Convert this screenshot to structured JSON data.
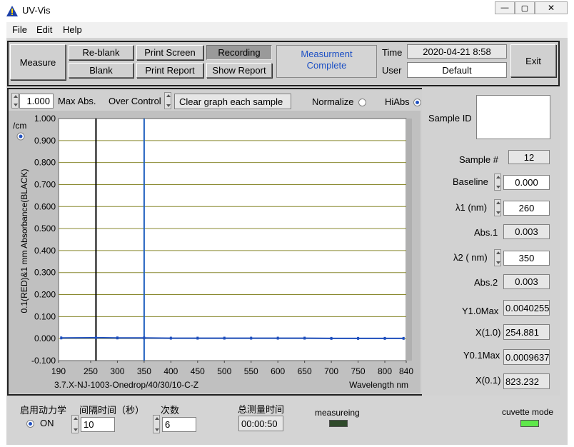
{
  "window": {
    "title": "UV-Vis",
    "minimize": "—",
    "maximize": "▢",
    "close": "✕"
  },
  "menu": [
    "File",
    "Edit",
    "Help"
  ],
  "toolbar": {
    "measure": "Measure",
    "reblank": "Re-blank",
    "blank": "Blank",
    "print_screen": "Print Screen",
    "print_report": "Print Report",
    "recording": "Recording",
    "show_report": "Show Report",
    "status": "Measurment Complete",
    "time_label": "Time",
    "time_value": "2020-04-21 8:58",
    "user_label": "User",
    "user_value": "Default",
    "exit": "Exit"
  },
  "controls": {
    "max_abs_value": "1.000",
    "max_abs_label": "Max Abs.",
    "over_control_label": "Over Control",
    "over_control_value": "Clear graph each sample",
    "normalize_label": "Normalize",
    "normalize_on": false,
    "hiabs_label": "HiAbs",
    "hiabs_on": true
  },
  "chart_data": {
    "type": "line",
    "unit_label": "/cm",
    "ylabel": "0.1(RED)&1 mm Absorbance(BLACK)",
    "xlabel": "Wavelength nm",
    "sample_caption": "3.7.X-NJ-1003-Onedrop/40/30/10-C-Z",
    "xlim": [
      190,
      840
    ],
    "ylim": [
      -0.1,
      1.0
    ],
    "x_ticks": [
      "190",
      "250",
      "300",
      "350",
      "400",
      "450",
      "500",
      "550",
      "600",
      "650",
      "700",
      "750",
      "800",
      "840"
    ],
    "x_tick_values": [
      190,
      250,
      300,
      350,
      400,
      450,
      500,
      550,
      600,
      650,
      700,
      750,
      800,
      840
    ],
    "y_ticks": [
      "1.000",
      "0.900",
      "0.800",
      "0.700",
      "0.600",
      "0.500",
      "0.400",
      "0.300",
      "0.200",
      "0.100",
      "0.000",
      "-0.100"
    ],
    "y_tick_values": [
      1.0,
      0.9,
      0.8,
      0.7,
      0.6,
      0.5,
      0.4,
      0.3,
      0.2,
      0.1,
      0.0,
      -0.1
    ],
    "cursors": [
      {
        "x": 260,
        "color": "#000000"
      },
      {
        "x": 350,
        "color": "#1f5fbf"
      }
    ],
    "series": [
      {
        "color": "#1f4fbf",
        "x": [
          195,
          260,
          300,
          350,
          400,
          450,
          500,
          550,
          600,
          650,
          700,
          750,
          800,
          835
        ],
        "y": [
          0.003,
          0.004,
          0.003,
          0.003,
          0.002,
          0.002,
          0.002,
          0.002,
          0.002,
          0.002,
          0.001,
          0.001,
          0.001,
          0.001
        ]
      }
    ],
    "grid_color": "#8a8a30",
    "grid": true
  },
  "panel": {
    "sample_id_label": "Sample ID",
    "sample_id_value": "",
    "sample_no_label": "Sample #",
    "sample_no_value": "12",
    "baseline_label": "Baseline",
    "baseline_value": "0.000",
    "l1_label": "λ1 (nm)",
    "l1_value": "260",
    "abs1_label": "Abs.1",
    "abs1_value": "0.003",
    "l2_label": "λ2 ( nm)",
    "l2_value": "350",
    "abs2_label": "Abs.2",
    "abs2_value": "0.003",
    "y10max_label": "Y1.0Max",
    "y10max_value": "0.0040255",
    "x10_label": "X(1.0)",
    "x10_value": "254.881",
    "y01max_label": "Y0.1Max",
    "y01max_value": "0.0009637",
    "x01_label": "X(0.1)",
    "x01_value": "823.232"
  },
  "bottom": {
    "kinetics_label": "启用动力学",
    "kinetics_on_label": "ON",
    "interval_label": "间隔时间（秒）",
    "interval_value": "10",
    "count_label": "次数",
    "count_value": "6",
    "total_label": "总测量时间",
    "total_value": "00:00:50",
    "measuring_label": "measureing",
    "cuvette_label": "cuvette mode",
    "measuring_led_color": "#2f4a2a",
    "cuvette_led_color": "#5ee84a"
  }
}
